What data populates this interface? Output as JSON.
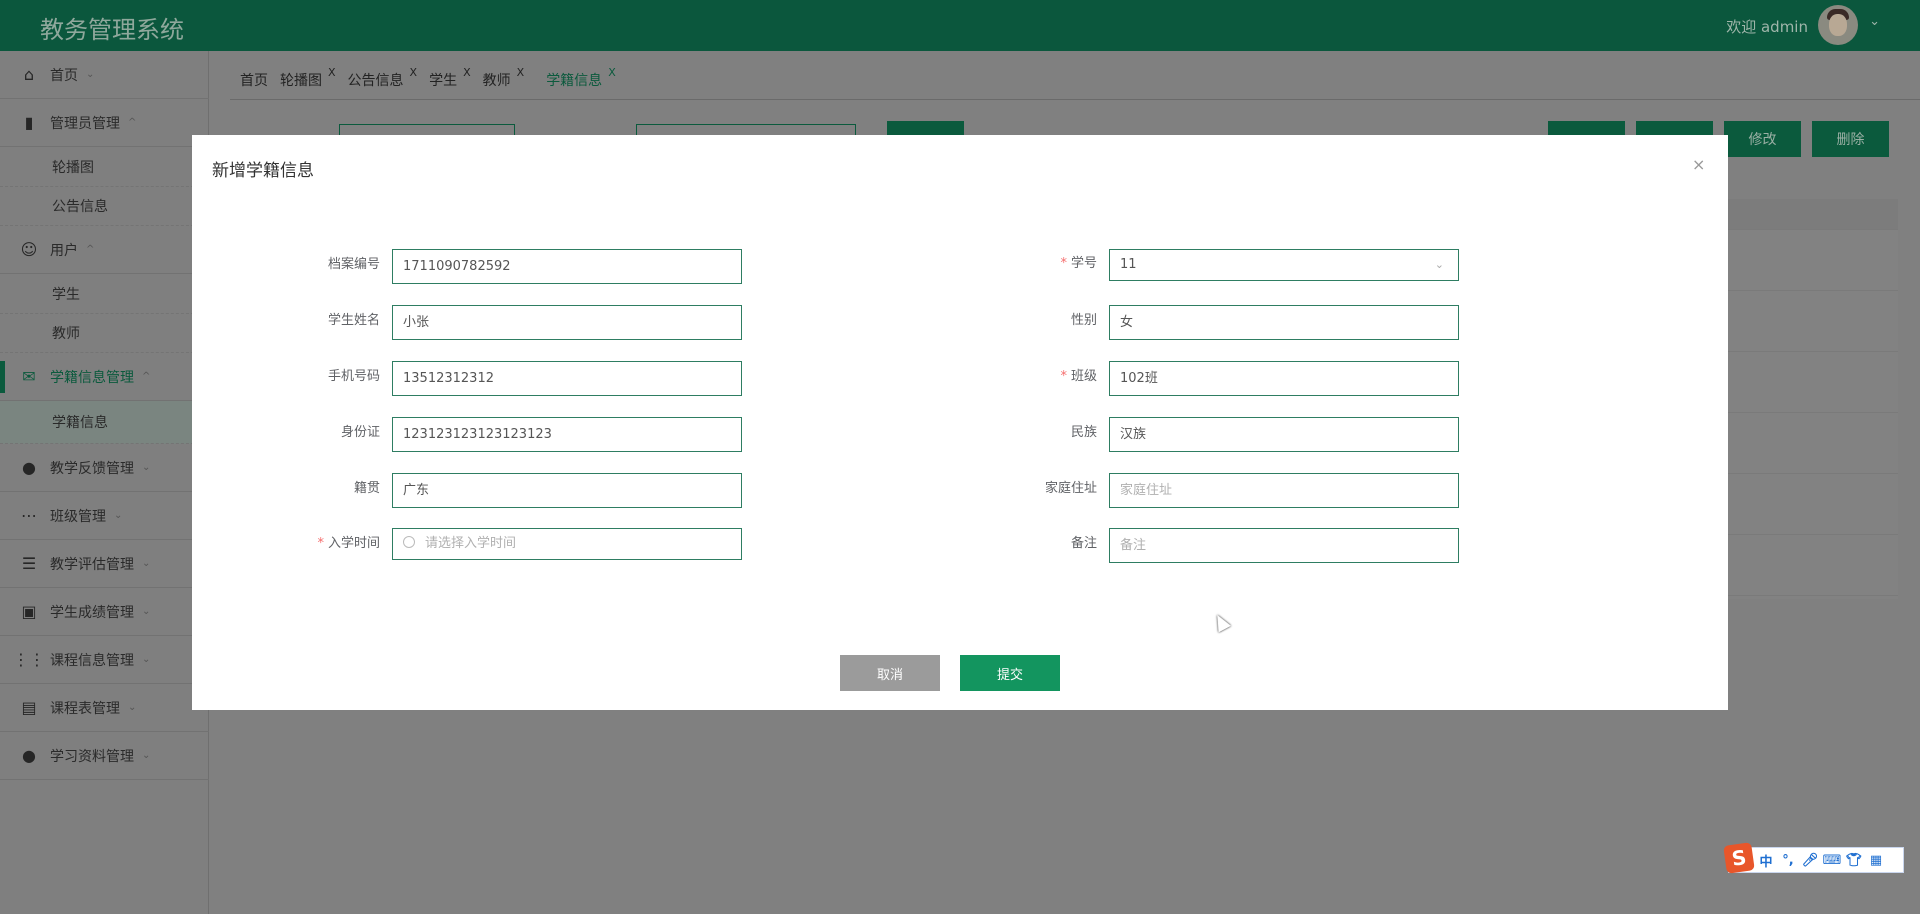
{
  "header": {
    "title": "教务管理系统",
    "welcome": "欢迎 admin"
  },
  "sidebar": {
    "items": [
      {
        "label": "首页",
        "caret": "⌄"
      },
      {
        "label": "管理员管理",
        "caret": "^"
      },
      {
        "label": "轮播图"
      },
      {
        "label": "公告信息"
      },
      {
        "label": "用户",
        "caret": "^"
      },
      {
        "label": "学生"
      },
      {
        "label": "教师"
      },
      {
        "label": "学籍信息管理",
        "caret": "^"
      },
      {
        "label": "学籍信息"
      },
      {
        "label": "教学反馈管理",
        "caret": "⌄"
      },
      {
        "label": "班级管理",
        "caret": "⌄"
      },
      {
        "label": "教学评估管理",
        "caret": "⌄"
      },
      {
        "label": "学生成绩管理",
        "caret": "⌄"
      },
      {
        "label": "课程信息管理",
        "caret": "⌄"
      },
      {
        "label": "课程表管理",
        "caret": "⌄"
      },
      {
        "label": "学习资料管理",
        "caret": "⌄"
      }
    ]
  },
  "tabs": [
    {
      "label": "首页"
    },
    {
      "label": "轮播图",
      "close": "X"
    },
    {
      "label": "公告信息",
      "close": "X"
    },
    {
      "label": "学生",
      "close": "X"
    },
    {
      "label": "教师",
      "close": "X"
    },
    {
      "label": "学籍信息",
      "close": "X"
    }
  ],
  "toolbar": {
    "edit": "修改",
    "delete": "删除"
  },
  "modal": {
    "title": "新增学籍信息",
    "close": "×",
    "left": [
      {
        "label": "档案编号",
        "value": "1711090782592"
      },
      {
        "label": "学生姓名",
        "value": "小张"
      },
      {
        "label": "手机号码",
        "value": "13512312312"
      },
      {
        "label": "身份证",
        "value": "123123123123123123"
      },
      {
        "label": "籍贯",
        "value": "广东"
      },
      {
        "label": "入学时间",
        "required": "*",
        "placeholder": "请选择入学时间"
      }
    ],
    "right": [
      {
        "label": "学号",
        "required": "*",
        "value": "11"
      },
      {
        "label": "性别",
        "value": "女"
      },
      {
        "label": "班级",
        "required": "*",
        "value": "102班"
      },
      {
        "label": "民族",
        "value": "汉族"
      },
      {
        "label": "家庭住址",
        "placeholder": "家庭住址"
      },
      {
        "label": "备注",
        "placeholder": "备注"
      }
    ],
    "cancel": "取消",
    "submit": "提交"
  },
  "ime": {
    "logo": "S",
    "mode": "中",
    "punct": "°,"
  }
}
